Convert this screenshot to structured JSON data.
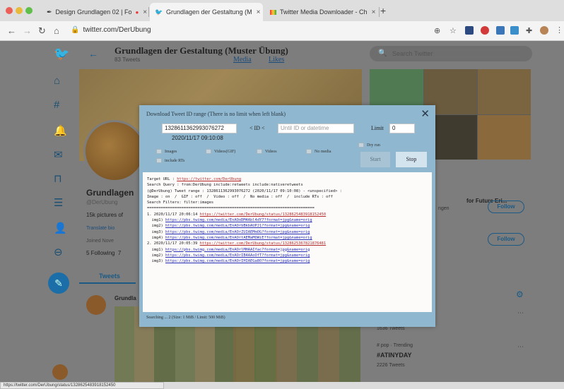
{
  "browser": {
    "tabs": [
      {
        "title": "Design Grundlagen 02 | Fo",
        "icon": "pen-nib-icon"
      },
      {
        "title": "Grundlagen der Gestaltung (M",
        "icon": "twitter-bird-icon"
      },
      {
        "title": "Twitter Media Downloader - Ch",
        "icon": "chrome-webstore-icon"
      }
    ],
    "close_glyph": "×",
    "new_tab_glyph": "+",
    "url": "twitter.com/DerUbung",
    "status_url": "https://twitter.com/DerUbung/status/1328625483918152450"
  },
  "profile": {
    "title": "Grundlagen der Gestaltung (Muster Übung)",
    "subtitle": "83 Tweets",
    "media_link": "Media",
    "likes_link": "Likes",
    "name": "Grundlagen",
    "handle": "@DerUbung",
    "bio": "15k pictures of",
    "link": "Translate bio",
    "joined": "Joined Nove",
    "following": "5 Following",
    "following_extra": "7",
    "tweets_tab": "Tweets",
    "tweet_name": "Grundla"
  },
  "sidebar": {
    "search_placeholder": "Search Twitter",
    "card_title": "for Future Eri...",
    "card_sub": "ngen",
    "follow_label": "Follow",
    "trends": [
      {
        "label": "1636 Tweets",
        "big": false
      },
      {
        "label": "# pop · Trending",
        "big": false
      },
      {
        "label": "#ATINYDAY",
        "big": true
      },
      {
        "label": "2226 Tweets",
        "big": false
      }
    ]
  },
  "modal": {
    "header": "Download Tweet ID range (There is no limit when left blank)",
    "from_id": "1328611362993076272",
    "id_label": "< ID <",
    "until_placeholder": "Until ID or datetime",
    "limit_label": "Limit",
    "limit_value": "0",
    "from_date": "2020/11/17 09:10:08",
    "dry_run": "Dry run",
    "options": [
      "Images",
      "Videos(GIF)",
      "Videos",
      "No media",
      "include RTs"
    ],
    "start_label": "Start",
    "stop_label": "Stop",
    "status": "Searching ... 2   (Size: 1 MiB / Limit: 500 MiB)",
    "log": {
      "target_label": "Target URL : ",
      "target_url": "https://twitter.com/DerUbung",
      "query_line": "Search Query : from:DerUbung include:retweets include:nativeretweets",
      "range_line": "(@DerUbung) Tweet range : 1328611362993076272 (2020/11/17 09:10:08) - <unspecified> :",
      "filter_line": "Image : on  /  GIF : off  /  Video : off  /  No media : off  /  include RTs : off",
      "search_filters": "Search Filters: filter:images",
      "separator": "=========================================================================",
      "entries": [
        {
          "head": "1. 2020/11/17 20:06:14 ",
          "url": "https://twitter.com/DerUbung/status/1328625483918152450",
          "imgs": [
            {
              "label": "  img1) ",
              "url": "https://pbs.twimg.com/media/EnAOoDM4Abl4dY7?format=jpg&name=orig"
            },
            {
              "label": "  img2) ",
              "url": "https://pbs.twimg.com/media/EnAOrbBkbAUPJ1?format=jpg&name=orig"
            },
            {
              "label": "  img3) ",
              "url": "https://pbs.twimg.com/media/EnAOrZUIAEMmOG?format=jpg&name=orig"
            },
            {
              "label": "  img4) ",
              "url": "https://pbs.twimg.com/media/EnAOrtAEMaMOWiE?format=jpg&name=orig"
            }
          ]
        },
        {
          "head": "2. 2020/11/17 20:05:39 ",
          "url": "https://twitter.com/DerUbung/status/1328625367821876481",
          "imgs": [
            {
              "label": "  img1) ",
              "url": "https://pbs.twimg.com/media/EnAOrlMHAAIfac?format=jpg&name=orig"
            },
            {
              "label": "  img2) ",
              "url": "https://pbs.twimg.com/media/EnAOrIB4AAoOfT?format=jpg&name=orig"
            },
            {
              "label": "  img3) ",
              "url": "https://pbs.twimg.com/media/EnAOrIHIAEGa8O?format=jpg&name=orig"
            }
          ]
        }
      ]
    }
  },
  "colors": {
    "modal_bg": "#8fb7cf",
    "twitter_blue": "#1b5a85",
    "link_blue": "#2a31b7",
    "link_red": "#b32a2a"
  }
}
